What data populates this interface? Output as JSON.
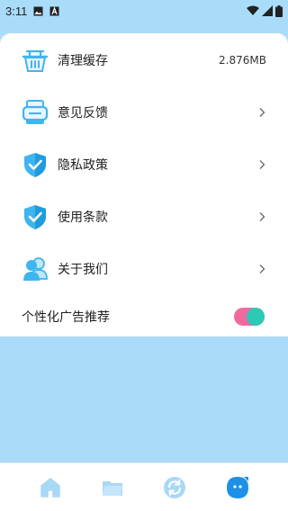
{
  "status_bar": {
    "time": "3:11",
    "icons": [
      "image-icon",
      "a-badge-icon",
      "wifi-icon",
      "signal-icon",
      "battery-icon"
    ]
  },
  "settings": {
    "items": [
      {
        "icon": "basket-icon",
        "label": "清理缓存",
        "value": "2.876MB"
      },
      {
        "icon": "printer-icon",
        "label": "意见反馈"
      },
      {
        "icon": "shield-check-icon",
        "label": "隐私政策"
      },
      {
        "icon": "shield-check-icon",
        "label": "使用条款"
      },
      {
        "icon": "users-icon",
        "label": "关于我们"
      }
    ],
    "toggle": {
      "label": "个性化广告推荐",
      "on": true
    }
  },
  "bottom_nav": {
    "items": [
      {
        "icon": "home-icon"
      },
      {
        "icon": "folder-icon"
      },
      {
        "icon": "sync-icon"
      },
      {
        "icon": "profile-icon",
        "active": true
      }
    ]
  },
  "colors": {
    "background": "#a9dcf8",
    "accent": "#3fb5f0",
    "toggle_track": "#f06aa0",
    "toggle_knob": "#2cc9b4",
    "active_nav": "#1e90e8",
    "inactive_nav": "#a9d8f5"
  }
}
